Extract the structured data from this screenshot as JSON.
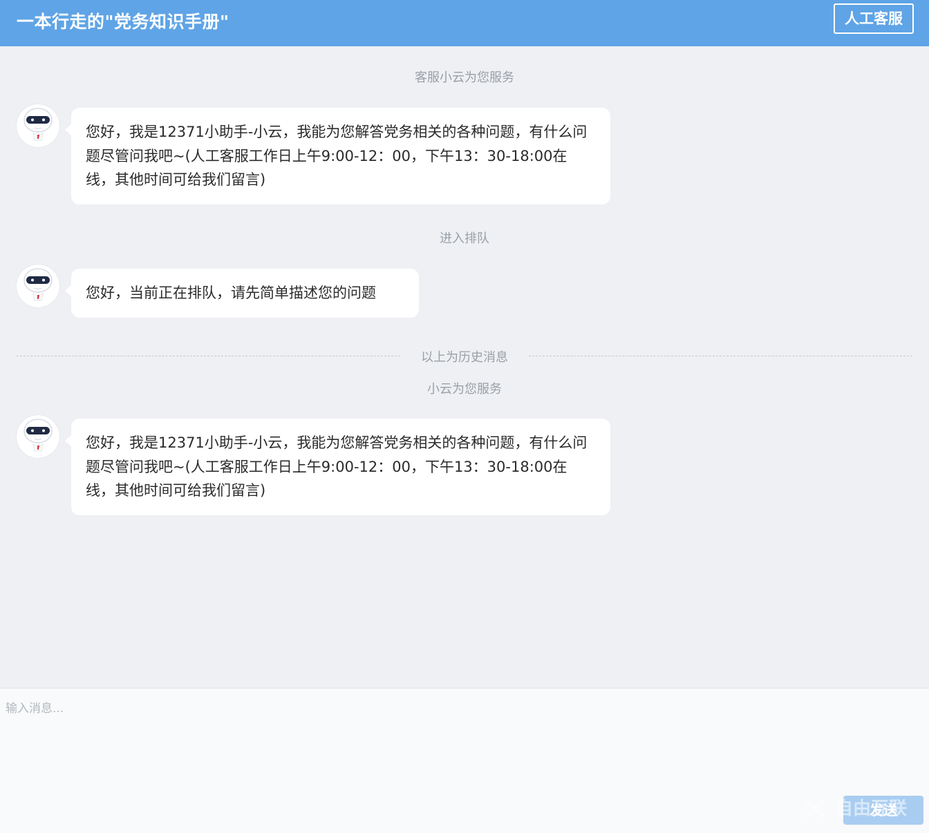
{
  "header": {
    "title": "一本行走的\"党务知识手册\"",
    "human_service_label": "人工客服"
  },
  "messages": {
    "system_1": "客服小云为您服务",
    "bot_1": "您好，我是12371小助手-小云，我能为您解答党务相关的各种问题，有什么问题尽管问我吧~(人工客服工作日上午9:00-12：00，下午13：30-18:00在线，其他时间可给我们留言)",
    "system_2": "进入排队",
    "bot_2": "您好，当前正在排队，请先简单描述您的问题",
    "history_divider": "以上为历史消息",
    "system_3": "小云为您服务",
    "bot_3": "您好，我是12371小助手-小云，我能为您解答党务相关的各种问题，有什么问题尽管问我吧~(人工客服工作日上午9:00-12：00，下午13：30-18:00在线，其他时间可给我们留言)"
  },
  "input": {
    "placeholder": "输入消息...",
    "send_label": "发送"
  },
  "watermark": "自由互联",
  "colors": {
    "header": "#5fa4e6",
    "chat_bg": "#eef0f3",
    "send_button": "#a9cdf1"
  },
  "icons": {
    "avatar": "robot-icon"
  }
}
